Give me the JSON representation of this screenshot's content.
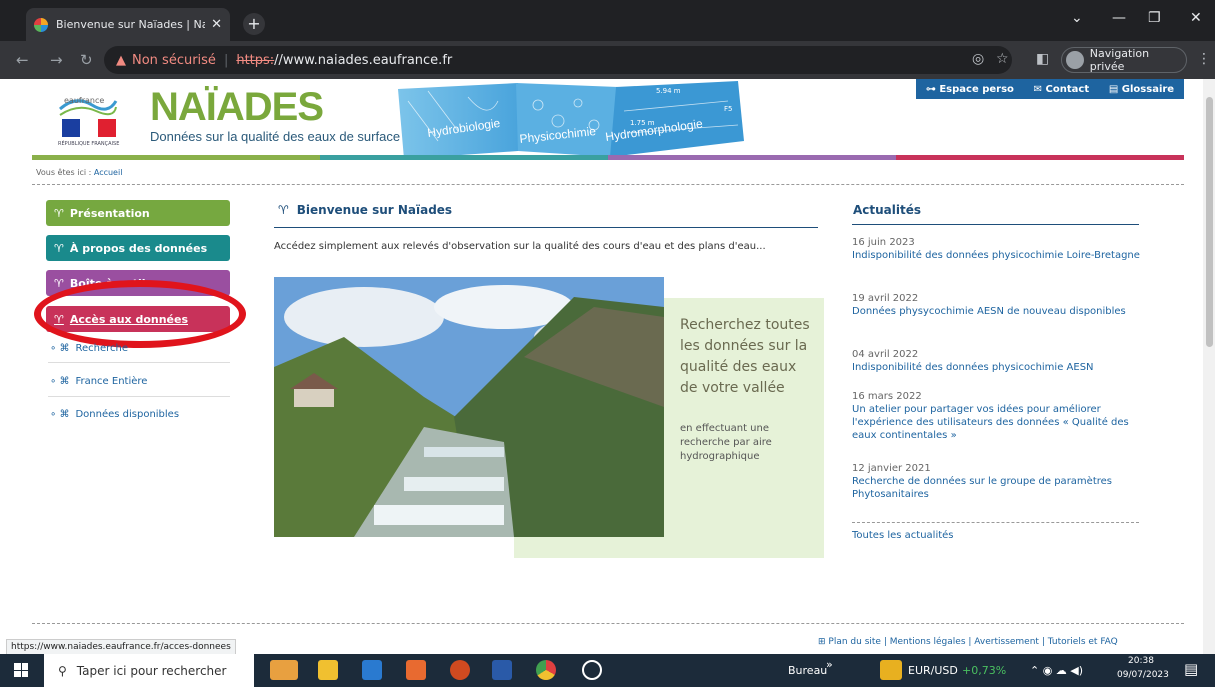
{
  "browser": {
    "tab_title": "Bienvenue sur Naïades | Naïade",
    "not_secure": "Non sécurisé",
    "url_scheme": "https:",
    "url_rest": "//www.naiades.eaufrance.fr",
    "private_label": "Navigation privée"
  },
  "header": {
    "brand": "NAÏADES",
    "tagline": "Données sur la qualité des eaux de surface",
    "eau_small": "eaufrance",
    "republique": "RÉPUBLIQUE FRANÇAISE",
    "banner_words": [
      "Hydrobiologie",
      "Physicochimie",
      "Hydromorphologie"
    ],
    "banner_nums": [
      "5.94 m",
      "F5",
      "1.75 m"
    ],
    "topnav": [
      "Espace perso",
      "Contact",
      "Glossaire"
    ]
  },
  "breadcrumb": {
    "prefix": "Vous êtes ici :",
    "current": "Accueil"
  },
  "menu": {
    "items": [
      {
        "label": "Présentation",
        "color": "#76a840"
      },
      {
        "label": "À propos des données",
        "color": "#1a8a8c"
      },
      {
        "label": "Boîte à outils",
        "color": "#9a4fa0"
      },
      {
        "label": "Accès aux données",
        "color": "#c8325a"
      }
    ],
    "subitems": [
      "Recherche",
      "France Entière",
      "Données disponibles"
    ]
  },
  "main": {
    "title": "Bienvenue sur Naïades",
    "intro": "Accédez simplement aux relevés d'observation sur la qualité des cours d'eau et des plans d'eau...",
    "promo_big": "Recherchez toutes les données sur la qualité des eaux de votre vallée",
    "promo_small": "en effectuant une recherche par aire hydrographique"
  },
  "news": {
    "title": "Actualités",
    "items": [
      {
        "date": "16 juin 2023",
        "text": "Indisponibilité des données physicochimie Loire-Bretagne"
      },
      {
        "date": "19 avril 2022",
        "text": "Données physycochimie AESN de nouveau disponibles"
      },
      {
        "date": "04 avril 2022",
        "text": "Indisponibilité des données physicochimie AESN"
      },
      {
        "date": "16 mars 2022",
        "text": "Un atelier pour partager vos idées pour améliorer l'expérience des utilisateurs des données « Qualité des eaux continentales »"
      },
      {
        "date": "12 janvier 2021",
        "text": "Recherche de données sur le groupe de paramètres Phytosanitaires"
      }
    ],
    "all": "Toutes les actualités"
  },
  "footer": {
    "links": [
      "Plan du site",
      "Mentions légales",
      "Avertissement",
      "Tutoriels et FAQ"
    ]
  },
  "status_url": "https://www.naiades.eaufrance.fr/acces-donnees",
  "taskbar": {
    "search": "Taper ici pour rechercher",
    "bureau": "Bureau",
    "fx": "EUR/USD",
    "fx_change": "+0,73%",
    "time": "20:38",
    "date": "09/07/2023"
  }
}
